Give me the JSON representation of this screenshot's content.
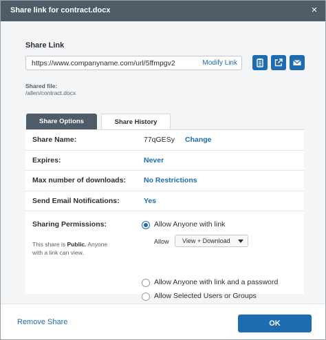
{
  "window": {
    "title": "Share link for contract.docx",
    "close_glyph": "×"
  },
  "share_link": {
    "section_title": "Share Link",
    "url": "https://www.companyname.com/url/5ffmpgv2",
    "modify_label": "Modify Link",
    "icons": [
      "clipboard-icon",
      "open-external-icon",
      "email-icon"
    ]
  },
  "shared_file": {
    "label": "Shared file:",
    "path": "/allen/contract.docx"
  },
  "tabs": [
    {
      "label": "Share Options",
      "active": true
    },
    {
      "label": "Share History",
      "active": false
    }
  ],
  "options": {
    "share_name": {
      "label": "Share Name:",
      "value": "77qGESy",
      "action": "Change"
    },
    "expires": {
      "label": "Expires:",
      "value": "Never"
    },
    "max_downloads": {
      "label": "Max number of downloads:",
      "value": "No Restrictions"
    },
    "email_notifications": {
      "label": "Send Email Notifications:",
      "value": "Yes"
    },
    "permissions": {
      "label": "Sharing Permissions:",
      "note_prefix": "This share is ",
      "note_bold": "Public.",
      "note_suffix": " Anyone with a link can view.",
      "choices": [
        {
          "label": "Allow Anyone with link",
          "checked": true
        },
        {
          "label": "Allow Anyone with link and a password",
          "checked": false
        },
        {
          "label": "Allow Selected Users or Groups",
          "checked": false
        }
      ],
      "allow_label": "Allow",
      "allow_value": "View + Download"
    }
  },
  "footer": {
    "remove_label": "Remove Share",
    "ok_label": "OK"
  },
  "colors": {
    "accent": "#1d6cb0",
    "titlebar": "#4f5b66"
  }
}
